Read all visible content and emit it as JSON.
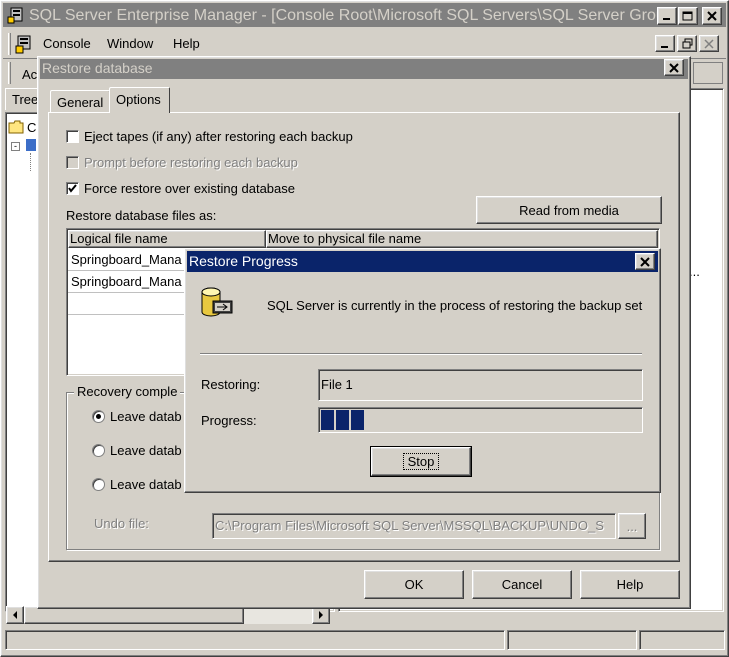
{
  "main_window": {
    "title": "SQL Server Enterprise Manager - [Console Root\\Microsoft SQL Servers\\SQL Server Grou...",
    "menu": [
      "Console",
      "Window",
      "Help"
    ],
    "toolbar_partial": "Ac",
    "tree_tab": "Tree",
    "tree_item": "C",
    "ellipsis": "..."
  },
  "restore_dialog": {
    "title": "Restore database",
    "tabs": [
      "General",
      "Options"
    ],
    "eject_tapes": "Eject tapes (if any) after restoring each backup",
    "prompt_before": "Prompt before restoring each backup",
    "force_restore": "Force restore over existing database",
    "restore_files_as": "Restore database files as:",
    "read_from_media": "Read from media",
    "table_headers": [
      "Logical file name",
      "Move to physical file name"
    ],
    "table_rows": [
      "Springboard_Mana",
      "Springboard_Mana"
    ],
    "recovery_group": "Recovery comple",
    "radio_options": [
      "Leave datab",
      "Leave datab",
      "Leave datab"
    ],
    "undo_file_label": "Undo file:",
    "undo_file_value": "C:\\Program Files\\Microsoft SQL Server\\MSSQL\\BACKUP\\UNDO_S",
    "browse_label": "...",
    "ok": "OK",
    "cancel": "Cancel",
    "help": "Help"
  },
  "progress_dialog": {
    "title": "Restore Progress",
    "message": "SQL Server is currently in the process of restoring the backup set",
    "restoring_label": "Restoring:",
    "restoring_value": "File 1",
    "progress_label": "Progress:",
    "progress_fraction": 0.14,
    "stop": "Stop"
  },
  "colors": {
    "face": "#d4d0c8",
    "active_title": "#0a246a",
    "inactive_title": "#808080",
    "progress": "#0a246a"
  }
}
